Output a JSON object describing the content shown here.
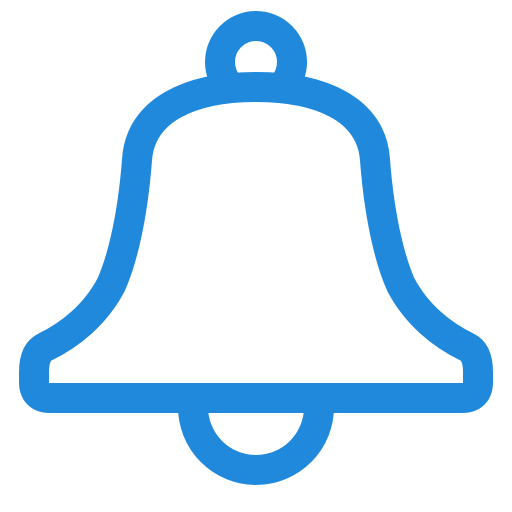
{
  "icon": {
    "name": "bell-icon",
    "stroke_color": "#2089DC",
    "fill_color": "#ffffff"
  }
}
